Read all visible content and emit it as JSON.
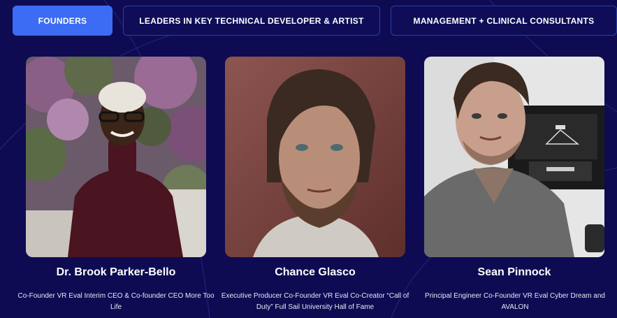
{
  "tabs": [
    {
      "label": "FOUNDERS",
      "active": true
    },
    {
      "label": "LEADERS IN KEY TECHNICAL DEVELOPER & ARTIST",
      "active": false
    },
    {
      "label": "MANAGEMENT + CLINICAL CONSULTANTS",
      "active": false
    }
  ],
  "team": [
    {
      "name": "Dr. Brook Parker-Bello",
      "role": "Co-Founder VR Eval Interim CEO & Co-founder CEO More Too Life",
      "photo": "portrait-woman-turtleneck-flowers"
    },
    {
      "name": "Chance Glasco",
      "role": "Executive Producer Co-Founder VR Eval Co-Creator “Call of Duty” Full Sail University Hall of Fame",
      "photo": "portrait-man-beard-red-wall"
    },
    {
      "name": "Sean Pinnock",
      "role": "Principal Engineer Co-Founder VR Eval Cyber Dream and AVALON",
      "photo": "portrait-man-monitors"
    }
  ],
  "colors": {
    "background": "#0e0b52",
    "accent": "#3c6cf3",
    "tab_border": "#2b3fa8"
  }
}
